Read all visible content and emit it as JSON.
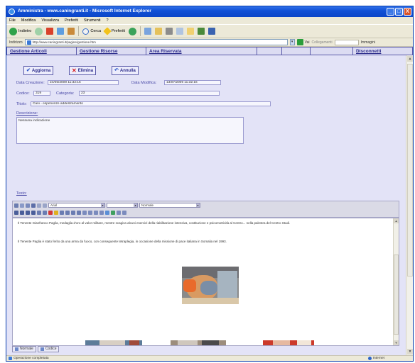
{
  "window": {
    "title": "Amministra - www.caningranti.it - Microsoft Internet Explorer",
    "buttons": {
      "minimize": "_",
      "maximize": "□",
      "close": "X"
    }
  },
  "menubar": {
    "items": [
      "File",
      "Modifica",
      "Visualizza",
      "Preferiti",
      "Strumenti",
      "?"
    ]
  },
  "toolbar": {
    "back": "Indietro",
    "search": "Cerca",
    "favorites": "Preferiti",
    "icons": [
      "back-icon",
      "forward-icon",
      "stop-icon",
      "refresh-icon",
      "home-icon",
      "search-icon",
      "favorites-icon",
      "media-icon",
      "history-icon",
      "mail-icon",
      "print-icon",
      "edit-icon",
      "folder-icon",
      "messenger-icon"
    ]
  },
  "addressbar": {
    "label": "Indirizzo",
    "url": "http://www.caningranti.it/pagine/gestione.htm",
    "go_label": "Vai",
    "links_label": "Collegamenti",
    "search_placeholder": "",
    "images_label": "Immagini"
  },
  "nav": {
    "items": [
      "Gestione Articoli",
      "Gestione Risorse",
      "Area Riservata"
    ],
    "logout": "Disconnetti"
  },
  "actions": {
    "save": "Aggiorna",
    "delete": "Elimina",
    "cancel": "Annulla"
  },
  "form": {
    "created_label": "Data Creazione:",
    "created_value": "24/05/2009 11:32:16",
    "modified_label": "Data Modifica:",
    "modified_value": "13/07/2009 11:32:16",
    "code_label": "Codice:",
    "code_value": "319",
    "category_label": "Categoria:",
    "category_value": "23",
    "title_label": "Titolo:",
    "title_value": "Cani - esperienze addestramento",
    "description_label": "Descrizione:",
    "description_value": "Nessuna indicazione",
    "text_label": "Testo:"
  },
  "editor": {
    "font_value": "Arial",
    "size_value": "",
    "style_value": "Normale",
    "paragraph1": "Il Tenente Gianfranco Paglia, medaglia d'oro al valor militare, mentre scagiva alcuni esercizi della riabilitazione intensiva, costituzione e psicomotricità al Centro... nella palestra del Centro Studi.",
    "paragraph2": "Il Tenente Paglia è stato ferito da una arma da fuoco, con conseguente tetraplegia, in occasione della missione di pace italiana in Somalia nel 1993.",
    "mode_tabs": [
      "Normale",
      "Codice"
    ]
  },
  "status": {
    "left": "Operazione completata",
    "right": "Internet"
  },
  "colors": {
    "form_bg": "#e3e3f7",
    "label": "#4a4aa8",
    "nav_text": "#2a2a8a",
    "title_bar": "#1251d6"
  }
}
